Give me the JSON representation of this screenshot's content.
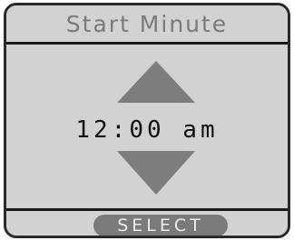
{
  "screen": {
    "title": "Start Minute",
    "time_value": "12:00 am",
    "increment_icon": "triangle-up-icon",
    "decrement_icon": "triangle-down-icon"
  },
  "footer": {
    "select_label": "SELECT"
  },
  "colors": {
    "panel_background": "#d2d2d2",
    "frame_border": "#2a2a2a",
    "divider": "#1a1a1a",
    "title_text": "#7a7a7a",
    "arrow_fill": "#7d7d7d",
    "time_text": "#111111",
    "button_background": "#7a7a7a",
    "button_text": "#ececec"
  }
}
